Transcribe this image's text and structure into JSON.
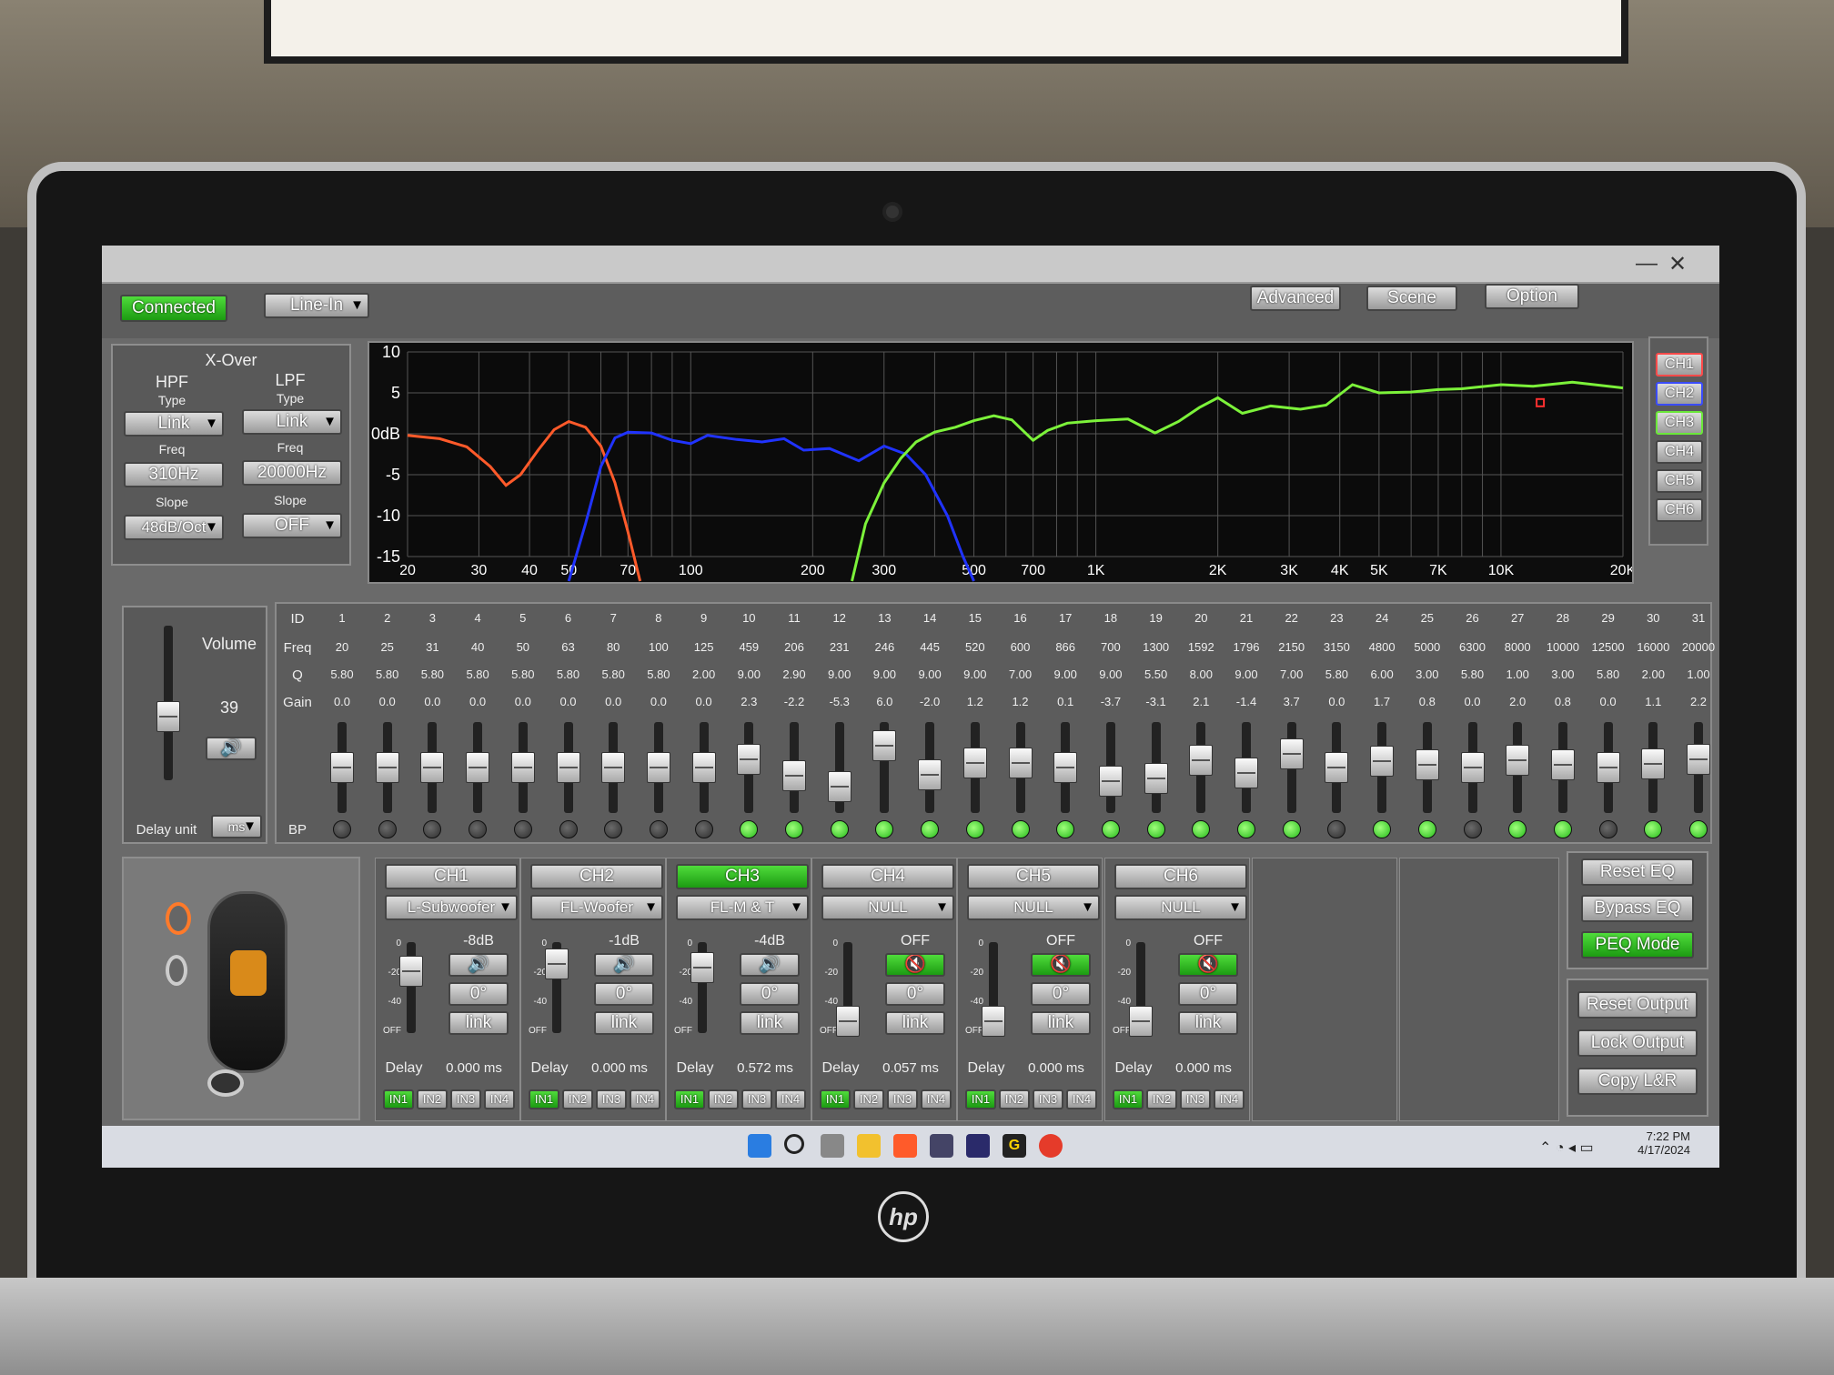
{
  "window": {
    "minimize": "—",
    "close": "✕"
  },
  "top": {
    "status": "Connected",
    "input": "Line-In",
    "advanced": "Advanced",
    "scene": "Scene",
    "option": "Option"
  },
  "xover": {
    "title": "X-Over",
    "hpf": "HPF",
    "lpf": "LPF",
    "type_label": "Type",
    "freq_label": "Freq",
    "slope_label": "Slope",
    "hpf_type": "Link",
    "lpf_type": "Link",
    "hpf_freq": "310Hz",
    "lpf_freq": "20000Hz",
    "hpf_slope": "48dB/Oct",
    "lpf_slope": "OFF"
  },
  "graph": {
    "y_ticks": [
      "10",
      "5",
      "0dB",
      "-5",
      "-10",
      "-15"
    ],
    "x_ticks": [
      "20",
      "30",
      "40",
      "50",
      "70",
      "100",
      "200",
      "300",
      "500",
      "700",
      "1K",
      "2K",
      "3K",
      "4K",
      "5K",
      "7K",
      "10K",
      "20K"
    ],
    "colors": {
      "ch1": "#ff5a2a",
      "ch2": "#2033ff",
      "ch3": "#7cf23a",
      "marker": "#ff3030"
    }
  },
  "channel_select": [
    "CH1",
    "CH2",
    "CH3",
    "CH4",
    "CH5",
    "CH6"
  ],
  "volume": {
    "label": "Volume",
    "value": "39",
    "delay_unit_label": "Delay unit",
    "delay_unit": "ms",
    "level": 0.39
  },
  "eq": {
    "row_labels": {
      "id": "ID",
      "freq": "Freq",
      "q": "Q",
      "gain": "Gain",
      "bp": "BP"
    },
    "ids": [
      "1",
      "2",
      "3",
      "4",
      "5",
      "6",
      "7",
      "8",
      "9",
      "10",
      "11",
      "12",
      "13",
      "14",
      "15",
      "16",
      "17",
      "18",
      "19",
      "20",
      "21",
      "22",
      "23",
      "24",
      "25",
      "26",
      "27",
      "28",
      "29",
      "30",
      "31"
    ],
    "freqs": [
      "20",
      "25",
      "31",
      "40",
      "50",
      "63",
      "80",
      "100",
      "125",
      "459",
      "206",
      "231",
      "246",
      "445",
      "520",
      "600",
      "866",
      "700",
      "1300",
      "1592",
      "1796",
      "2150",
      "3150",
      "4800",
      "5000",
      "6300",
      "8000",
      "10000",
      "12500",
      "16000",
      "20000"
    ],
    "q": [
      "5.80",
      "5.80",
      "5.80",
      "5.80",
      "5.80",
      "5.80",
      "5.80",
      "5.80",
      "2.00",
      "9.00",
      "2.90",
      "9.00",
      "9.00",
      "9.00",
      "9.00",
      "7.00",
      "9.00",
      "9.00",
      "5.50",
      "8.00",
      "9.00",
      "7.00",
      "5.80",
      "6.00",
      "3.00",
      "5.80",
      "1.00",
      "3.00",
      "5.80",
      "2.00",
      "1.00"
    ],
    "gain": [
      "0.0",
      "0.0",
      "0.0",
      "0.0",
      "0.0",
      "0.0",
      "0.0",
      "0.0",
      "0.0",
      "2.3",
      "-2.2",
      "-5.3",
      "6.0",
      "-2.0",
      "1.2",
      "1.2",
      "0.1",
      "-3.7",
      "-3.1",
      "2.1",
      "-1.4",
      "3.7",
      "0.0",
      "1.7",
      "0.8",
      "0.0",
      "2.0",
      "0.8",
      "0.0",
      "1.1",
      "2.2"
    ],
    "bp": [
      false,
      false,
      false,
      false,
      false,
      false,
      false,
      false,
      false,
      true,
      true,
      true,
      true,
      true,
      true,
      true,
      true,
      true,
      true,
      true,
      true,
      true,
      false,
      true,
      true,
      false,
      true,
      true,
      false,
      true,
      true
    ]
  },
  "eq_buttons": {
    "reset_eq": "Reset EQ",
    "bypass_eq": "Bypass EQ",
    "peq_mode": "PEQ Mode",
    "reset_output": "Reset Output",
    "lock_output": "Lock Output",
    "copy_lr": "Copy L&R"
  },
  "scale": {
    "top": "0",
    "mid1": "-20",
    "mid2": "-40",
    "bottom": "OFF"
  },
  "channels": [
    {
      "name": "CH1",
      "speaker": "L-Subwoofer",
      "level": "-8dB",
      "phase": "0°",
      "link": "link",
      "delay_label": "Delay",
      "delay": "0.000 ms",
      "active_in": "IN1",
      "muted": false,
      "fader": 0.78
    },
    {
      "name": "CH2",
      "speaker": "FL-Woofer",
      "level": "-1dB",
      "phase": "0°",
      "link": "link",
      "delay_label": "Delay",
      "delay": "0.000 ms",
      "active_in": "IN1",
      "muted": false,
      "fader": 0.9
    },
    {
      "name": "CH3",
      "speaker": "FL-M & T",
      "level": "-4dB",
      "phase": "0°",
      "link": "link",
      "delay_label": "Delay",
      "delay": "0.572 ms",
      "active_in": "IN1",
      "muted": false,
      "fader": 0.85
    },
    {
      "name": "CH4",
      "speaker": "NULL",
      "level": "OFF",
      "phase": "0°",
      "link": "link",
      "delay_label": "Delay",
      "delay": "0.057 ms",
      "active_in": "IN1",
      "muted": true,
      "fader": 0.0
    },
    {
      "name": "CH5",
      "speaker": "NULL",
      "level": "OFF",
      "phase": "0°",
      "link": "link",
      "delay_label": "Delay",
      "delay": "0.000 ms",
      "active_in": "IN1",
      "muted": true,
      "fader": 0.0
    },
    {
      "name": "CH6",
      "speaker": "NULL",
      "level": "OFF",
      "phase": "0°",
      "link": "link",
      "delay_label": "Delay",
      "delay": "0.000 ms",
      "active_in": "IN1",
      "muted": true,
      "fader": 0.0
    }
  ],
  "inputs": [
    "IN1",
    "IN2",
    "IN3",
    "IN4"
  ],
  "tray": {
    "time": "7:22 PM",
    "date": "4/17/2024"
  }
}
